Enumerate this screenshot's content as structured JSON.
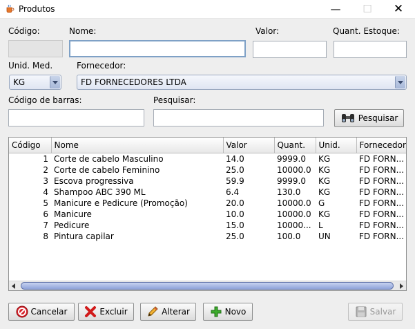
{
  "window": {
    "title": "Produtos"
  },
  "form": {
    "codigo_label": "Código:",
    "codigo_value": "",
    "nome_label": "Nome:",
    "nome_value": "",
    "valor_label": "Valor:",
    "valor_value": "",
    "estoque_label": "Quant. Estoque:",
    "estoque_value": "",
    "unid_label": "Unid. Med.",
    "unid_value": "KG",
    "fornecedor_label": "Fornecedor:",
    "fornecedor_value": "FD FORNECEDORES LTDA",
    "barras_label": "Código de barras:",
    "barras_value": "",
    "pesquisar_label": "Pesquisar:",
    "pesquisar_value": "",
    "pesquisar_button": "Pesquisar"
  },
  "table": {
    "columns": [
      "Código",
      "Nome",
      "Valor",
      "Quant.",
      "Unid.",
      "Fornecedor"
    ],
    "rows": [
      [
        "1",
        "Corte de cabelo Masculino",
        "14.0",
        "9999.0",
        "KG",
        "FD FORN..."
      ],
      [
        "2",
        "Corte de cabelo Feminino",
        "25.0",
        "10000.0",
        "KG",
        "FD FORN..."
      ],
      [
        "3",
        "Escova progressiva",
        "59.9",
        "9999.0",
        "KG",
        "FD FORN..."
      ],
      [
        "4",
        "Shampoo ABC 390 ML",
        "6.4",
        "130.0",
        "KG",
        "FD FORN..."
      ],
      [
        "5",
        "Manicure e Pedicure (Promoção)",
        "20.0",
        "10000.0",
        "G",
        "FD FORN..."
      ],
      [
        "6",
        "Manicure",
        "10.0",
        "10000.0",
        "KG",
        "FD FORN..."
      ],
      [
        "7",
        "Pedicure",
        "15.0",
        "10000...",
        "L",
        "FD FORN..."
      ],
      [
        "8",
        "Pintura capilar",
        "25.0",
        "100.0",
        "UN",
        "FD FORN..."
      ]
    ]
  },
  "buttons": {
    "cancelar": "Cancelar",
    "excluir": "Excluir",
    "alterar": "Alterar",
    "novo": "Novo",
    "salvar": "Salvar"
  },
  "icons": {
    "window": "app-cup-icon",
    "pesquisar": "binoculars-icon",
    "cancelar": "no-entry-icon",
    "excluir": "red-x-icon",
    "alterar": "pencil-icon",
    "novo": "green-plus-icon",
    "salvar": "floppy-disk-icon"
  }
}
